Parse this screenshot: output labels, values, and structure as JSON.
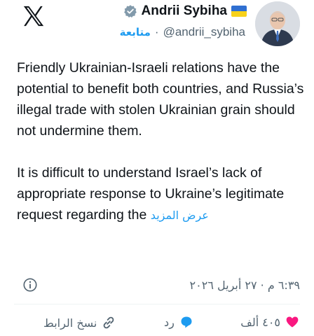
{
  "header": {
    "display_name": "Andrii Sybiha",
    "handle": "@andrii_sybiha",
    "follow_label": "متابعة",
    "separator": "·"
  },
  "tweet": {
    "paragraph_1": "Friendly Ukrainian-Israeli relations have the potential to benefit both countries, and Russia’s illegal trade with stolen Ukrainian grain should not undermine them.",
    "paragraph_2": "It is difficult to understand Israel’s lack of appropriate response to Ukraine’s legitimate request regarding the",
    "show_more_label": "عرض المزيد"
  },
  "meta": {
    "timestamp": "٦:٣٩ م · ٢٧ أبريل ٢٠٢٦"
  },
  "actions": {
    "like_count": "٤٠٥ ألف",
    "reply_label": "رد",
    "copy_link_label": "نسخ الرابط"
  },
  "colors": {
    "accent": "#1d9bf0",
    "like": "#f91880",
    "text": "#0f1419",
    "muted": "#536471",
    "verified": "#829aab",
    "flag_blue": "#2f6fd1",
    "flag_yellow": "#f7d11a"
  },
  "icons": [
    "x-logo-icon",
    "verified-badge-icon",
    "ukraine-flag-icon",
    "info-icon",
    "heart-icon",
    "reply-bubble-icon",
    "link-icon"
  ]
}
